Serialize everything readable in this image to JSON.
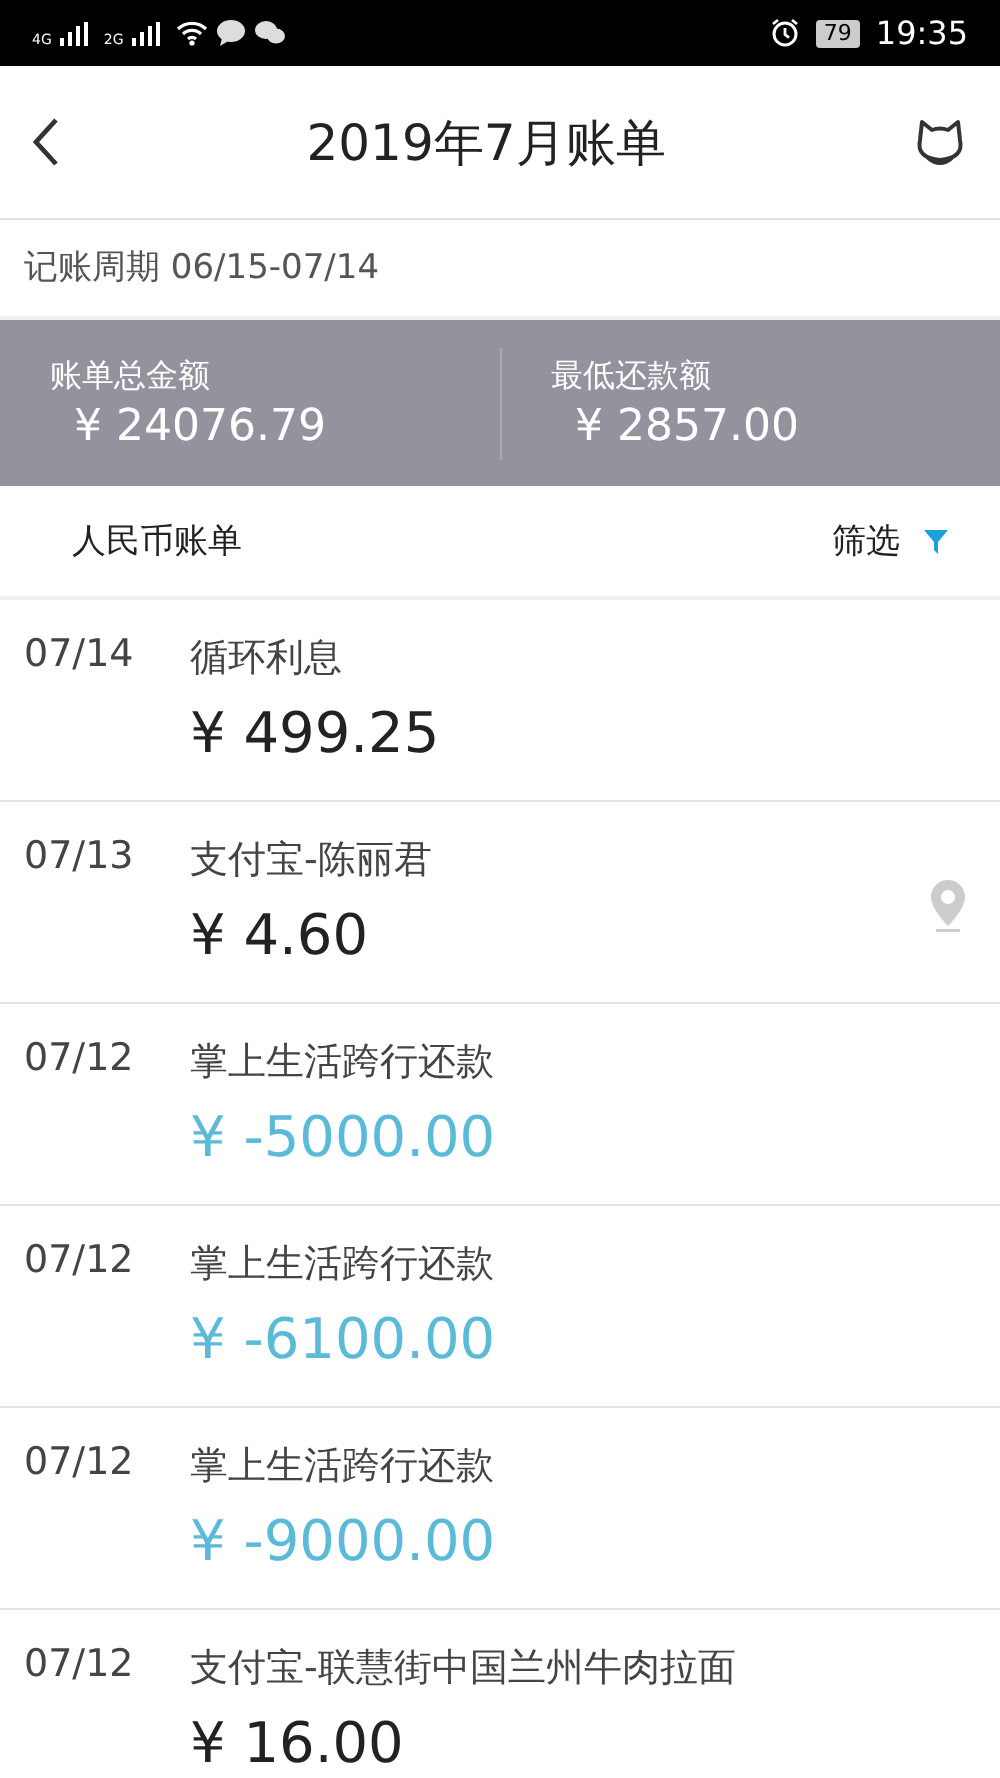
{
  "status_bar": {
    "networks": [
      "4G",
      "2G"
    ],
    "battery": "79",
    "time": "19:35"
  },
  "header": {
    "title": "2019年7月账单"
  },
  "period": "记账周期 06/15-07/14",
  "summary": [
    {
      "label": "账单总金额",
      "amount": "¥ 24076.79"
    },
    {
      "label": "最低还款额",
      "amount": "¥ 2857.00"
    }
  ],
  "currency_bar": {
    "title": "人民币账单",
    "filter": "筛选"
  },
  "transactions": [
    {
      "date": "07/14",
      "description": "循环利息",
      "amount": "¥ 499.25",
      "kind": "charge",
      "has_location": false
    },
    {
      "date": "07/13",
      "description": "支付宝-陈丽君",
      "amount": "¥ 4.60",
      "kind": "charge",
      "has_location": true
    },
    {
      "date": "07/12",
      "description": "掌上生活跨行还款",
      "amount": "¥ -5000.00",
      "kind": "payment",
      "has_location": false
    },
    {
      "date": "07/12",
      "description": "掌上生活跨行还款",
      "amount": "¥ -6100.00",
      "kind": "payment",
      "has_location": false
    },
    {
      "date": "07/12",
      "description": "掌上生活跨行还款",
      "amount": "¥ -9000.00",
      "kind": "payment",
      "has_location": false
    },
    {
      "date": "07/12",
      "description": "支付宝-联慧街中国兰州牛肉拉面",
      "amount": "¥ 16.00",
      "kind": "charge",
      "has_location": false
    }
  ]
}
